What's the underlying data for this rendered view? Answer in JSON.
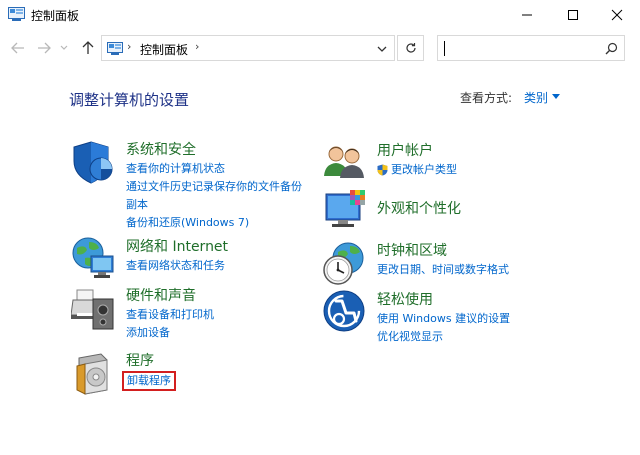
{
  "window": {
    "title": "控制面板"
  },
  "address_bar": {
    "crumb": "控制面板",
    "search_placeholder": ""
  },
  "main": {
    "heading": "调整计算机的设置",
    "view_by_label": "查看方式:",
    "view_by_value": "类别"
  },
  "categories": [
    {
      "icon": "shield-icon",
      "title": "系统和安全",
      "links": [
        "查看你的计算机状态",
        "通过文件历史记录保存你的文件备份",
        "副本",
        "备份和还原(Windows 7)"
      ]
    },
    {
      "icon": "network-globe-icon",
      "title": "网络和 Internet",
      "links": [
        "查看网络状态和任务"
      ]
    },
    {
      "icon": "printer-icon",
      "title": "硬件和声音",
      "links": [
        "查看设备和打印机",
        "添加设备"
      ]
    },
    {
      "icon": "programs-icon",
      "title": "程序",
      "links": [
        "卸载程序"
      ]
    },
    {
      "icon": "users-icon",
      "title": "用户帐户",
      "links": [
        "更改帐户类型"
      ]
    },
    {
      "icon": "appearance-icon",
      "title": "外观和个性化",
      "links": []
    },
    {
      "icon": "clock-globe-icon",
      "title": "时钟和区域",
      "links": [
        "更改日期、时间或数字格式"
      ]
    },
    {
      "icon": "ease-of-access-icon",
      "title": "轻松使用",
      "links": [
        "使用 Windows 建议的设置",
        "优化视觉显示"
      ]
    }
  ],
  "colors": {
    "heading": "#1e3287",
    "category_title": "#1f6e2a",
    "link": "#0066cc",
    "highlight_box": "#d31f1f"
  }
}
